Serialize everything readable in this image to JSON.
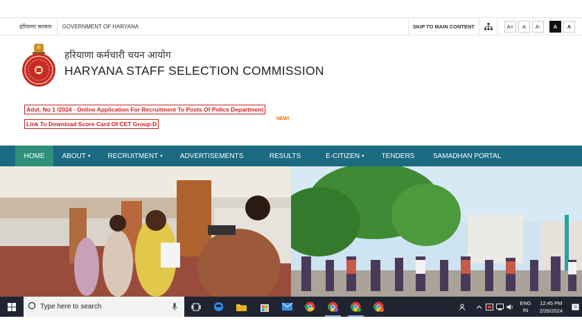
{
  "utility_bar": {
    "hindi_gov": "हरियाणा सरकार",
    "gov_label": "GOVERNMENT OF HARYANA",
    "skip_label": "SKIP TO MAIN CONTENT",
    "font_increase": "A+",
    "font_normal": "A",
    "font_decrease": "A-",
    "contrast_dark": "A",
    "contrast_light": "A"
  },
  "header": {
    "title_hindi": "हरियाणा कर्मचारी चयन आयोग",
    "title_english": "HARYANA STAFF SELECTION COMMISSION"
  },
  "announcements": {
    "advt": "Advt. No 1 /2024 - Online Application For Recruitment To Posts Of Police Department",
    "scorecard": "Link To Download Score Card Of CET Group-D",
    "new_tag": "NEW!"
  },
  "nav": {
    "items": [
      {
        "label": "HOME"
      },
      {
        "label": "ABOUT"
      },
      {
        "label": "RECRUITMENT"
      },
      {
        "label": "ADVERTISEMENTS"
      },
      {
        "label": "RESULTS"
      },
      {
        "label": "E-CITIZEN"
      },
      {
        "label": "TENDERS"
      },
      {
        "label": "SAMADHAN PORTAL"
      }
    ],
    "caret": "❯"
  },
  "taskbar": {
    "search_placeholder": "Type here to search",
    "lang_top": "ENG",
    "lang_bottom": "IN",
    "time": "12:45 PM",
    "date": "2/26/2024"
  },
  "colors": {
    "nav_bg": "#1b6a82",
    "nav_active": "#2f8f7a",
    "alert_red": "#d02020",
    "new_orange": "#ff6a00",
    "taskbar_bg": "#1f2430"
  }
}
